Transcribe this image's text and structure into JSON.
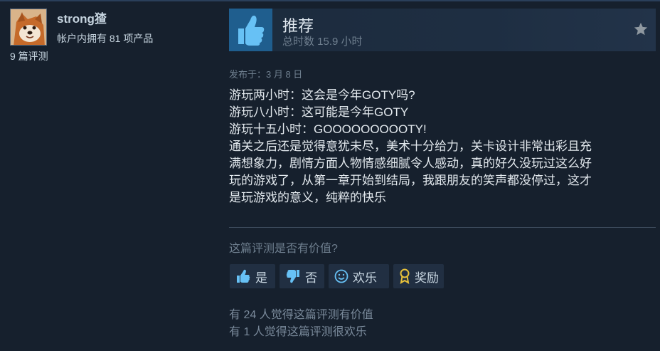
{
  "author": {
    "name": "strong猹",
    "products": "帐户内拥有 81 项产品",
    "reviews": "9 篇评测",
    "avatar_icon": "dog-avatar"
  },
  "review": {
    "title": "推荐",
    "hours": "总时数 15.9 小时",
    "thumb_icon": "thumbs-up-icon",
    "award_star_icon": "star-icon",
    "posted": "发布于：3 月 8 日",
    "body_lines": [
      "游玩两小时：这会是今年GOTY吗?",
      "游玩八小时：这可能是今年GOTY",
      "游玩十五小时：GOOOOOOOOOTY!",
      "通关之后还是觉得意犹未尽，美术十分给力，关卡设计非常出彩且充",
      "满想象力，剧情方面人物情感细腻令人感动，真的好久没玩过这么好",
      "玩的游戏了，从第一章开始到结局，我跟朋友的笑声都没停过，这才",
      "是玩游戏的意义，纯粹的快乐"
    ]
  },
  "feedback": {
    "question": "这篇评测是否有价值?",
    "buttons": {
      "yes": "是",
      "no": "否",
      "funny": "欢乐",
      "award": "奖励"
    },
    "helpful_count": "有 24 人觉得这篇评测有价值",
    "funny_count": "有 1 人觉得这篇评测很欢乐"
  },
  "colors": {
    "background": "#16202d",
    "thumb_box": "#1f5e8e",
    "thumb_icon": "#67c1f5",
    "award_icon": "#e8c23a"
  }
}
